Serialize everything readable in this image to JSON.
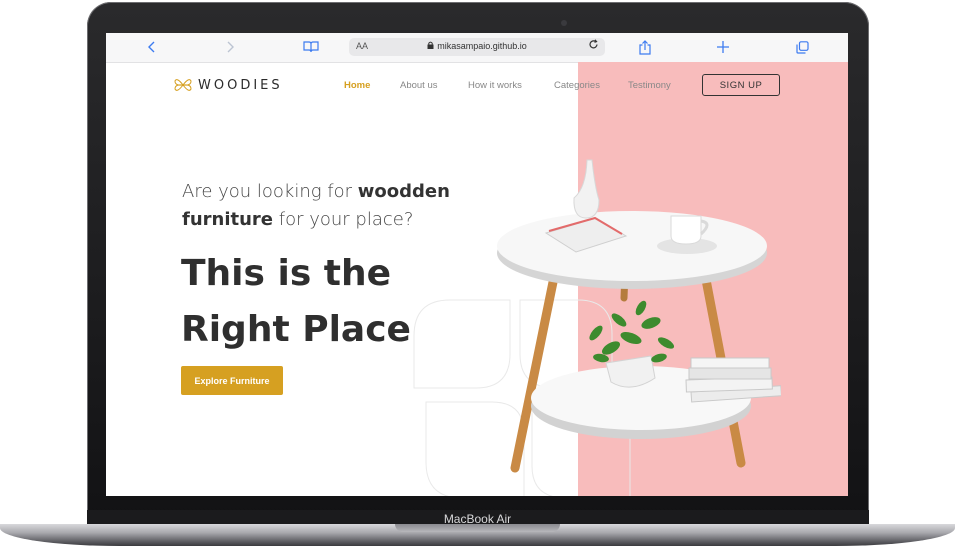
{
  "device": {
    "model_label": "MacBook Air"
  },
  "browser": {
    "text_size_label": "AA",
    "url": "mikasampaio.github.io",
    "icons": [
      "chevron-left-icon",
      "chevron-right-icon",
      "book-icon",
      "lock-icon",
      "reload-icon",
      "share-icon",
      "plus-icon",
      "tabs-icon"
    ]
  },
  "site": {
    "brand": "WOODIES",
    "nav": [
      {
        "label": "Home",
        "active": true
      },
      {
        "label": "About us",
        "active": false
      },
      {
        "label": "How it works",
        "active": false
      },
      {
        "label": "Categories",
        "active": false
      },
      {
        "label": "Testimony",
        "active": false
      }
    ],
    "signup_label": "SIGN UP",
    "lead": {
      "part1": "Are you looking for ",
      "bold1": "woodden",
      "bold2": "furniture",
      "part2": " for your place?"
    },
    "headline_line1": "This is the",
    "headline_line2": "Right Place",
    "cta_label": "Explore Furniture",
    "colors": {
      "accent": "#d6a021",
      "pink": "#f8bcbc",
      "text": "#2f2f2f"
    }
  }
}
